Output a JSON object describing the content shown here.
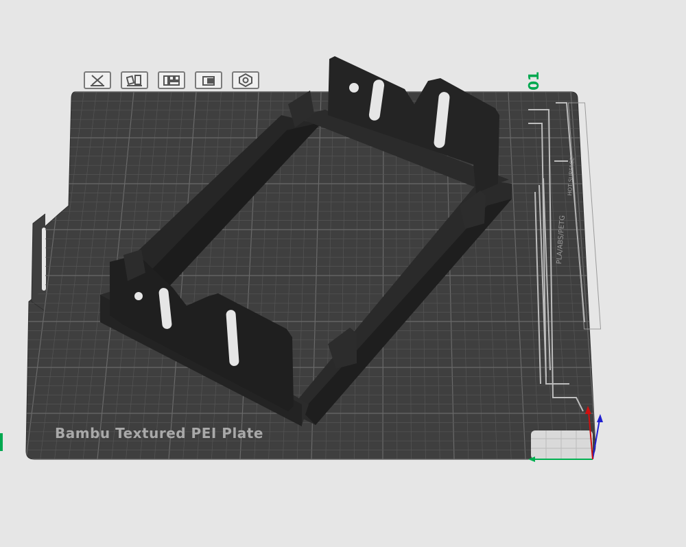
{
  "plate": {
    "index": "01",
    "name": "Bambu Textured PEI Plate",
    "material_text": "PLA/ABS/PETG",
    "warning_text": "HOT SURFACE"
  },
  "toolbar": {
    "buttons": [
      {
        "name": "remove-plate-button",
        "icon": "close-icon"
      },
      {
        "name": "arrange-button",
        "icon": "arrange-icon"
      },
      {
        "name": "orient-button",
        "icon": "orient-icon"
      },
      {
        "name": "lock-button",
        "icon": "lock-icon"
      },
      {
        "name": "settings-button",
        "icon": "hexagon-nut-icon"
      }
    ]
  },
  "axes": {
    "x_color": "#00b050",
    "y_color": "#2020d0",
    "z_color": "#d01010"
  },
  "colors": {
    "background": "#e6e6e6",
    "plate": "#3f3f3f",
    "grid": "#5a5a5a",
    "model": "#232323",
    "accent": "#00a84f"
  }
}
